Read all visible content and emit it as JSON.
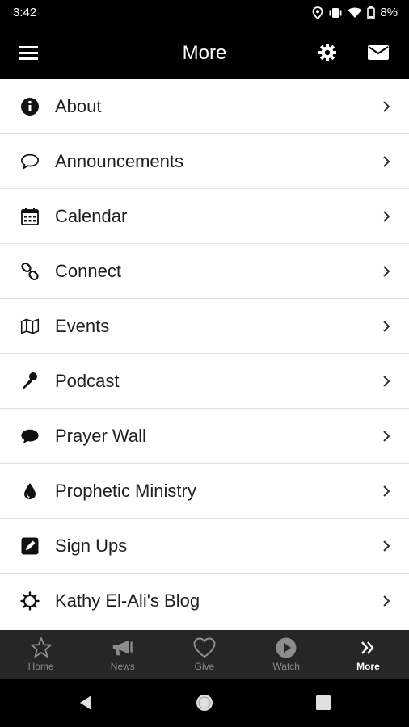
{
  "status": {
    "time": "3:42",
    "battery": "8%"
  },
  "appbar": {
    "title": "More",
    "icons": [
      "menu-icon",
      "gear-icon",
      "mail-icon"
    ]
  },
  "menu": {
    "items": [
      {
        "label": "About",
        "icon": "info-icon"
      },
      {
        "label": "Announcements",
        "icon": "speech-bubble-icon"
      },
      {
        "label": "Calendar",
        "icon": "calendar-icon"
      },
      {
        "label": "Connect",
        "icon": "link-icon"
      },
      {
        "label": "Events",
        "icon": "map-icon"
      },
      {
        "label": "Podcast",
        "icon": "microphone-icon"
      },
      {
        "label": "Prayer Wall",
        "icon": "comment-icon"
      },
      {
        "label": "Prophetic Ministry",
        "icon": "drop-icon"
      },
      {
        "label": "Sign Ups",
        "icon": "edit-icon"
      },
      {
        "label": "Kathy El-Ali's Blog",
        "icon": "sun-icon"
      }
    ]
  },
  "tabs": [
    {
      "label": "Home",
      "icon": "star-icon"
    },
    {
      "label": "News",
      "icon": "megaphone-icon"
    },
    {
      "label": "Give",
      "icon": "heart-icon"
    },
    {
      "label": "Watch",
      "icon": "play-icon"
    },
    {
      "label": "More",
      "icon": "double-chevron-icon"
    }
  ],
  "colors": {
    "bar": "#000000",
    "tabbar": "#262626",
    "active_tab": "#ffffff",
    "inactive_tab": "#8c8c8c"
  }
}
